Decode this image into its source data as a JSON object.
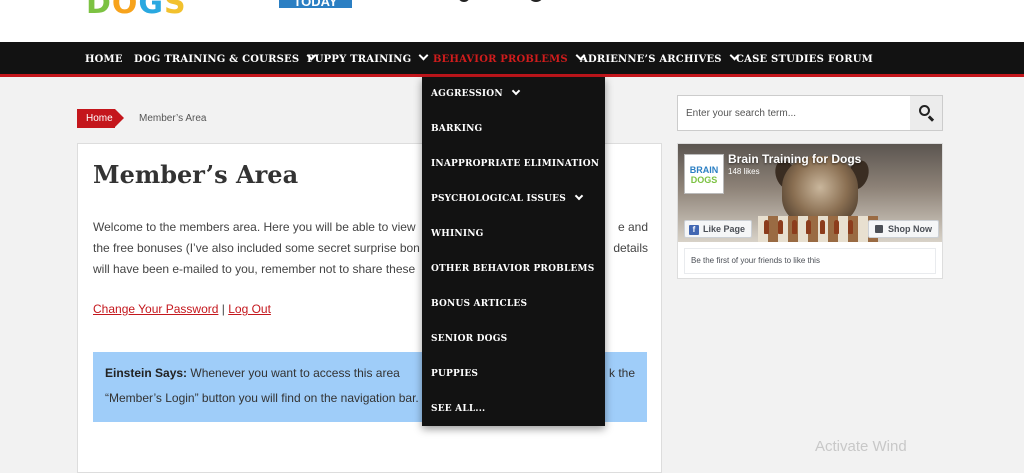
{
  "header": {
    "logo_dogs": [
      "D",
      "O",
      "G",
      "S"
    ],
    "logo_today": "TODAY"
  },
  "nav": {
    "items": [
      {
        "label": "HOME"
      },
      {
        "label": "DOG TRAINING & COURSES"
      },
      {
        "label": "PUPPY TRAINING"
      },
      {
        "label": "BEHAVIOR PROBLEMS"
      },
      {
        "label": "ADRIENNE’S ARCHIVES"
      },
      {
        "label": "CASE STUDIES"
      },
      {
        "label": "FORUM"
      }
    ],
    "active_color": "#d01c1c"
  },
  "dropdown": {
    "items": [
      {
        "label": "AGGRESSION"
      },
      {
        "label": "BARKING"
      },
      {
        "label": "INAPPROPRIATE ELIMINATION"
      },
      {
        "label": "PSYCHOLOGICAL ISSUES"
      },
      {
        "label": "WHINING"
      },
      {
        "label": "OTHER BEHAVIOR PROBLEMS"
      },
      {
        "label": "BONUS ARTICLES"
      },
      {
        "label": "SENIOR DOGS"
      },
      {
        "label": "PUPPIES"
      },
      {
        "label": "SEE ALL..."
      }
    ]
  },
  "breadcrumb": {
    "home": "Home",
    "current": "Member’s Area"
  },
  "main": {
    "title": "Member’s Area",
    "intro_1": "Welcome to the members area. Here you will be able to view ",
    "intro_2": "e and",
    "intro_3": "the free bonuses (I’ve also included some secret surprise bon",
    "intro_4": "details",
    "intro_5": "will have been e-mailed to you, remember not to share these",
    "change_password": "Change Your Password",
    "separator": " | ",
    "log_out": "Log Out",
    "einstein_label": "Einstein Says:",
    "einstein_text_1": " Whenever you want to access this area",
    "einstein_text_2": "k the",
    "einstein_text_3": "“Member’s Login” button you will find on the navigation bar."
  },
  "sidebar": {
    "search_placeholder": "Enter your search term...",
    "fb": {
      "page_name": "Brain Training for Dogs",
      "likes": "148 likes",
      "thumb_line1": "BRAIN",
      "thumb_line2": "DOGS",
      "like_button": "Like Page",
      "shop_button": "Shop Now",
      "friends_text": "Be the first of your friends to like this"
    }
  },
  "watermark": "Activate Wind"
}
